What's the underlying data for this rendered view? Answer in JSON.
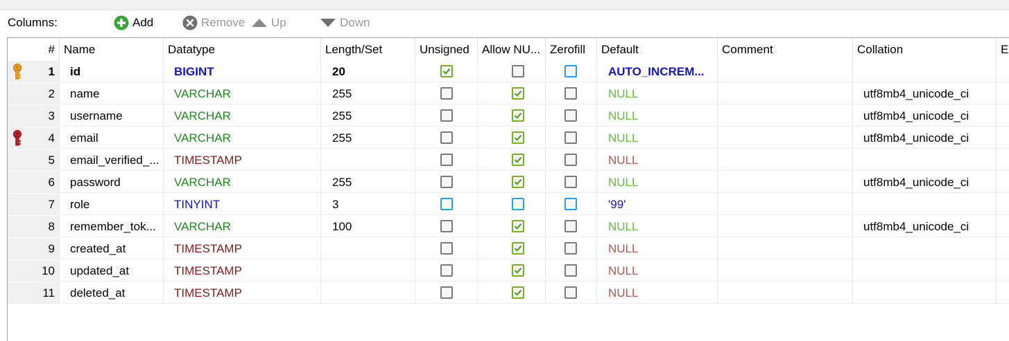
{
  "toolbar": {
    "columns_label": "Columns:",
    "add_label": "Add",
    "remove_label": "Remove",
    "up_label": "Up",
    "down_label": "Down"
  },
  "headers": [
    "#",
    "Name",
    "Datatype",
    "Length/Set",
    "Unsigned",
    "Allow NU...",
    "Zerofill",
    "Default",
    "Comment",
    "Collation",
    "Ex"
  ],
  "colors": {
    "green_type": "#1f8a1f",
    "blue_type": "#1515c8",
    "maroon_type": "#8b1a1a",
    "null_green": "#5fbf3a",
    "null_red": "#c05050",
    "check_green": "#70b030",
    "check_blue": "#2a9fe0"
  },
  "rows": [
    {
      "num": "1",
      "name": "id",
      "datatype": "BIGINT",
      "type_style": "blue",
      "length": "20",
      "unsigned": "checked",
      "allownull": "unchecked",
      "zerofill": "blue",
      "default": "AUTO_INCREM...",
      "default_style": "blue-bold",
      "comment": "",
      "collation": "",
      "key": "primary",
      "bold": true
    },
    {
      "num": "2",
      "name": "name",
      "datatype": "VARCHAR",
      "type_style": "green",
      "length": "255",
      "unsigned": "unchecked",
      "allownull": "checked",
      "zerofill": "unchecked",
      "default": "NULL",
      "default_style": "green",
      "comment": "",
      "collation": "utf8mb4_unicode_ci",
      "key": "",
      "bold": false
    },
    {
      "num": "3",
      "name": "username",
      "datatype": "VARCHAR",
      "type_style": "green",
      "length": "255",
      "unsigned": "unchecked",
      "allownull": "checked",
      "zerofill": "unchecked",
      "default": "NULL",
      "default_style": "green",
      "comment": "",
      "collation": "utf8mb4_unicode_ci",
      "key": "",
      "bold": false
    },
    {
      "num": "4",
      "name": "email",
      "datatype": "VARCHAR",
      "type_style": "green",
      "length": "255",
      "unsigned": "unchecked",
      "allownull": "checked",
      "zerofill": "unchecked",
      "default": "NULL",
      "default_style": "green",
      "comment": "",
      "collation": "utf8mb4_unicode_ci",
      "key": "unique",
      "bold": false
    },
    {
      "num": "5",
      "name": "email_verified_...",
      "datatype": "TIMESTAMP",
      "type_style": "maroon",
      "length": "",
      "unsigned": "unchecked",
      "allownull": "checked",
      "zerofill": "unchecked",
      "default": "NULL",
      "default_style": "red",
      "comment": "",
      "collation": "",
      "key": "",
      "bold": false
    },
    {
      "num": "6",
      "name": "password",
      "datatype": "VARCHAR",
      "type_style": "green",
      "length": "255",
      "unsigned": "unchecked",
      "allownull": "checked",
      "zerofill": "unchecked",
      "default": "NULL",
      "default_style": "green",
      "comment": "",
      "collation": "utf8mb4_unicode_ci",
      "key": "",
      "bold": false
    },
    {
      "num": "7",
      "name": "role",
      "datatype": "TINYINT",
      "type_style": "blue",
      "length": "3",
      "unsigned": "blue",
      "allownull": "blue",
      "zerofill": "blue",
      "default": "'99'",
      "default_style": "blue",
      "comment": "",
      "collation": "",
      "key": "",
      "bold": false
    },
    {
      "num": "8",
      "name": "remember_tok...",
      "datatype": "VARCHAR",
      "type_style": "green",
      "length": "100",
      "unsigned": "unchecked",
      "allownull": "checked",
      "zerofill": "unchecked",
      "default": "NULL",
      "default_style": "green",
      "comment": "",
      "collation": "utf8mb4_unicode_ci",
      "key": "",
      "bold": false
    },
    {
      "num": "9",
      "name": "created_at",
      "datatype": "TIMESTAMP",
      "type_style": "maroon",
      "length": "",
      "unsigned": "unchecked",
      "allownull": "checked",
      "zerofill": "unchecked",
      "default": "NULL",
      "default_style": "red",
      "comment": "",
      "collation": "",
      "key": "",
      "bold": false
    },
    {
      "num": "10",
      "name": "updated_at",
      "datatype": "TIMESTAMP",
      "type_style": "maroon",
      "length": "",
      "unsigned": "unchecked",
      "allownull": "checked",
      "zerofill": "unchecked",
      "default": "NULL",
      "default_style": "red",
      "comment": "",
      "collation": "",
      "key": "",
      "bold": false
    },
    {
      "num": "11",
      "name": "deleted_at",
      "datatype": "TIMESTAMP",
      "type_style": "maroon",
      "length": "",
      "unsigned": "unchecked",
      "allownull": "checked",
      "zerofill": "unchecked",
      "default": "NULL",
      "default_style": "red",
      "comment": "",
      "collation": "",
      "key": "",
      "bold": false
    }
  ]
}
